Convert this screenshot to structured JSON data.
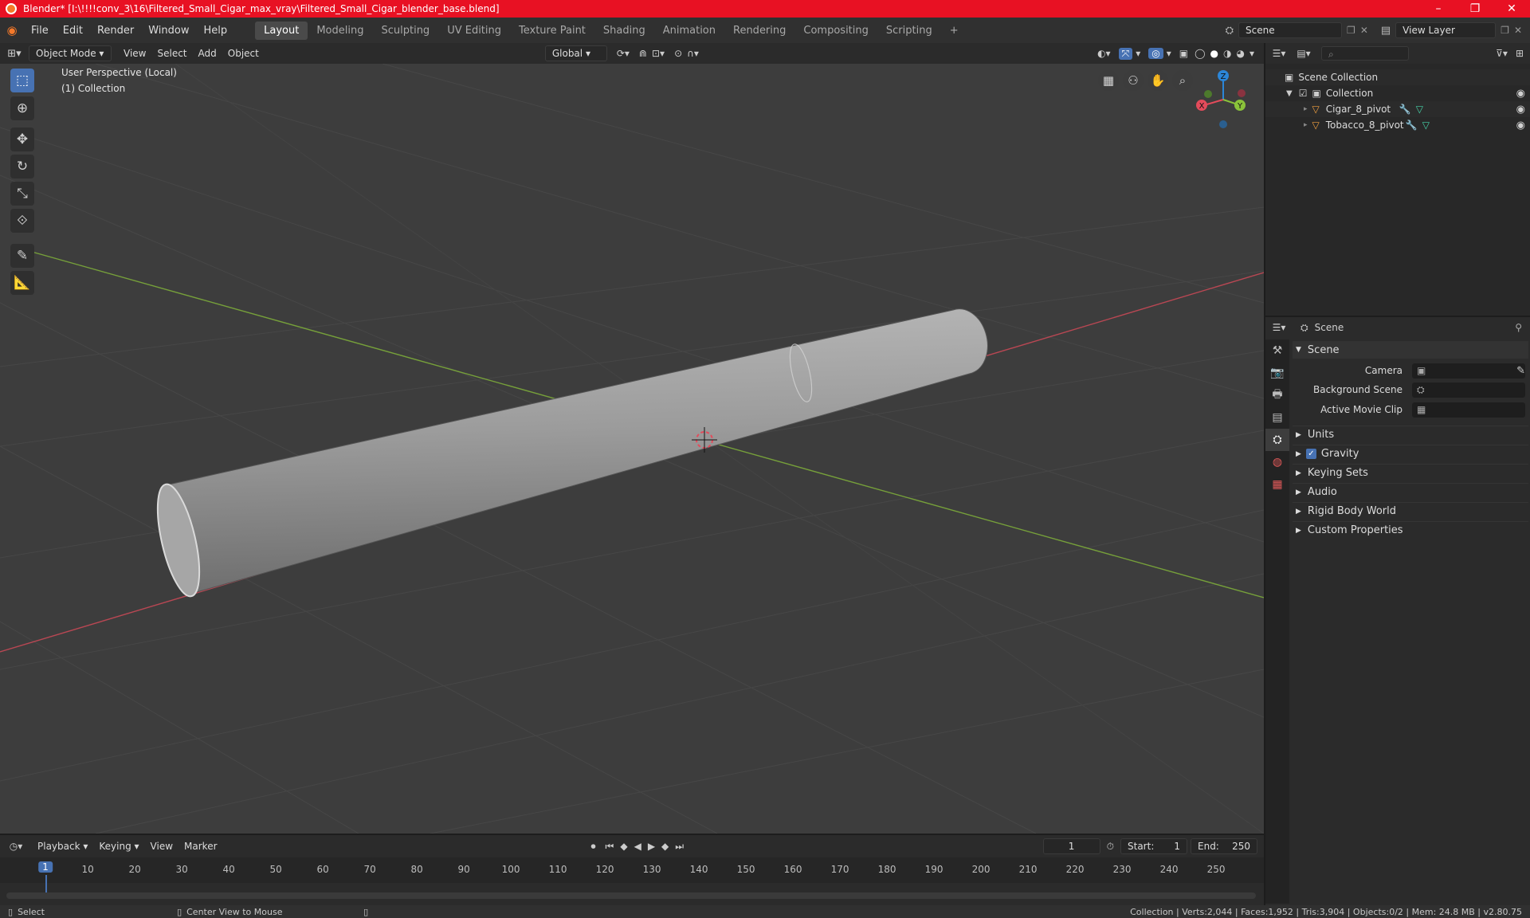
{
  "window": {
    "title": "Blender* [I:\\!!!!conv_3\\16\\Filtered_Small_Cigar_max_vray\\Filtered_Small_Cigar_blender_base.blend]",
    "minimize": "–",
    "maximize": "❐",
    "close": "✕"
  },
  "menu": [
    "File",
    "Edit",
    "Render",
    "Window",
    "Help"
  ],
  "workspaces": [
    "Layout",
    "Modeling",
    "Sculpting",
    "UV Editing",
    "Texture Paint",
    "Shading",
    "Animation",
    "Rendering",
    "Compositing",
    "Scripting"
  ],
  "active_workspace": "Layout",
  "add_workspace": "+",
  "scene_field": "Scene",
  "view_layer_field": "View Layer",
  "viewport_header": {
    "mode": "Object Mode",
    "view": "View",
    "select": "Select",
    "add": "Add",
    "object": "Object",
    "orientation": "Global"
  },
  "viewport": {
    "perspective": "User Perspective (Local)",
    "collection": "(1) Collection",
    "gizmo_x": "X",
    "gizmo_y": "Y",
    "gizmo_z": "Z"
  },
  "outliner": {
    "scene_collection": "Scene Collection",
    "collection": "Collection",
    "objects": [
      "Cigar_8_pivot",
      "Tobacco_8_pivot"
    ]
  },
  "properties": {
    "context": "Scene",
    "panel": "Scene",
    "fields": [
      {
        "label": "Camera"
      },
      {
        "label": "Background Scene"
      },
      {
        "label": "Active Movie Clip"
      }
    ],
    "sections": [
      "Units",
      "Gravity",
      "Keying Sets",
      "Audio",
      "Rigid Body World",
      "Custom Properties"
    ]
  },
  "timeline": {
    "menus": [
      "Playback",
      "Keying",
      "View",
      "Marker"
    ],
    "current_frame": "1",
    "start_label": "Start:",
    "start": "1",
    "end_label": "End:",
    "end": "250",
    "ticks": [
      "1",
      "10",
      "20",
      "30",
      "40",
      "50",
      "60",
      "70",
      "80",
      "90",
      "100",
      "110",
      "120",
      "130",
      "140",
      "150",
      "160",
      "170",
      "180",
      "190",
      "200",
      "210",
      "220",
      "230",
      "240",
      "250"
    ]
  },
  "statusbar": {
    "select": "Select",
    "center_view": "Center View to Mouse",
    "stats": "Collection | Verts:2,044 | Faces:1,952 | Tris:3,904 | Objects:0/2 | Mem: 24.8 MB | v2.80.75"
  },
  "colors": {
    "title_bar": "#e81123",
    "active_tool": "#4772b3",
    "axis_x": "#e34b5b",
    "axis_y": "#8ac23a",
    "axis_z": "#2b86d8"
  }
}
